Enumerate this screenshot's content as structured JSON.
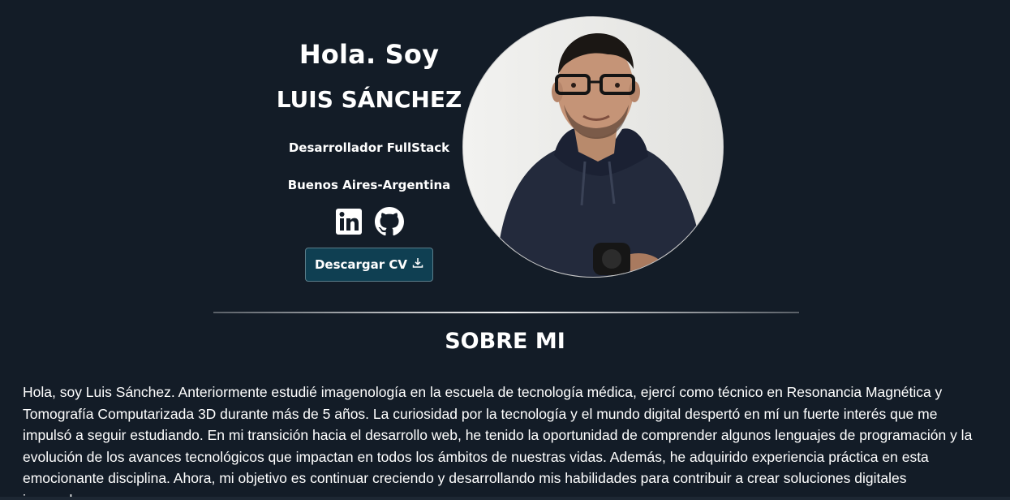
{
  "hero": {
    "greeting": "Hola. Soy",
    "name": "LUIS SÁNCHEZ",
    "role": "Desarrollador FullStack",
    "location": "Buenos Aires-Argentina",
    "cv_button_label": "Descargar CV",
    "socials": [
      {
        "icon": "linkedin-icon"
      },
      {
        "icon": "github-icon"
      }
    ],
    "photo": {
      "icon": "profile-photo"
    }
  },
  "about": {
    "title": "SOBRE MI",
    "text": "Hola, soy Luis Sánchez. Anteriormente estudié imagenología en la escuela de tecnología médica, ejercí como técnico en Resonancia Magnética y Tomografía Computarizada 3D durante más de 5 años. La curiosidad por la tecnología y el mundo digital despertó en mí un fuerte interés que me impulsó a seguir estudiando. En mi transición hacia el desarrollo web, he tenido la oportunidad de comprender algunos lenguajes de programación y la evolución de los avances tecnológicos que impactan en todos los ámbitos de nuestras vidas. Además, he adquirido experiencia práctica en esta emocionante disciplina. Ahora, mi objetivo es continuar creciendo y desarrollando mis habilidades para contribuir a crear soluciones digitales innovadoras."
  },
  "colors": {
    "background": "#131c27",
    "button": "#0f3f52",
    "text": "#ffffff"
  }
}
